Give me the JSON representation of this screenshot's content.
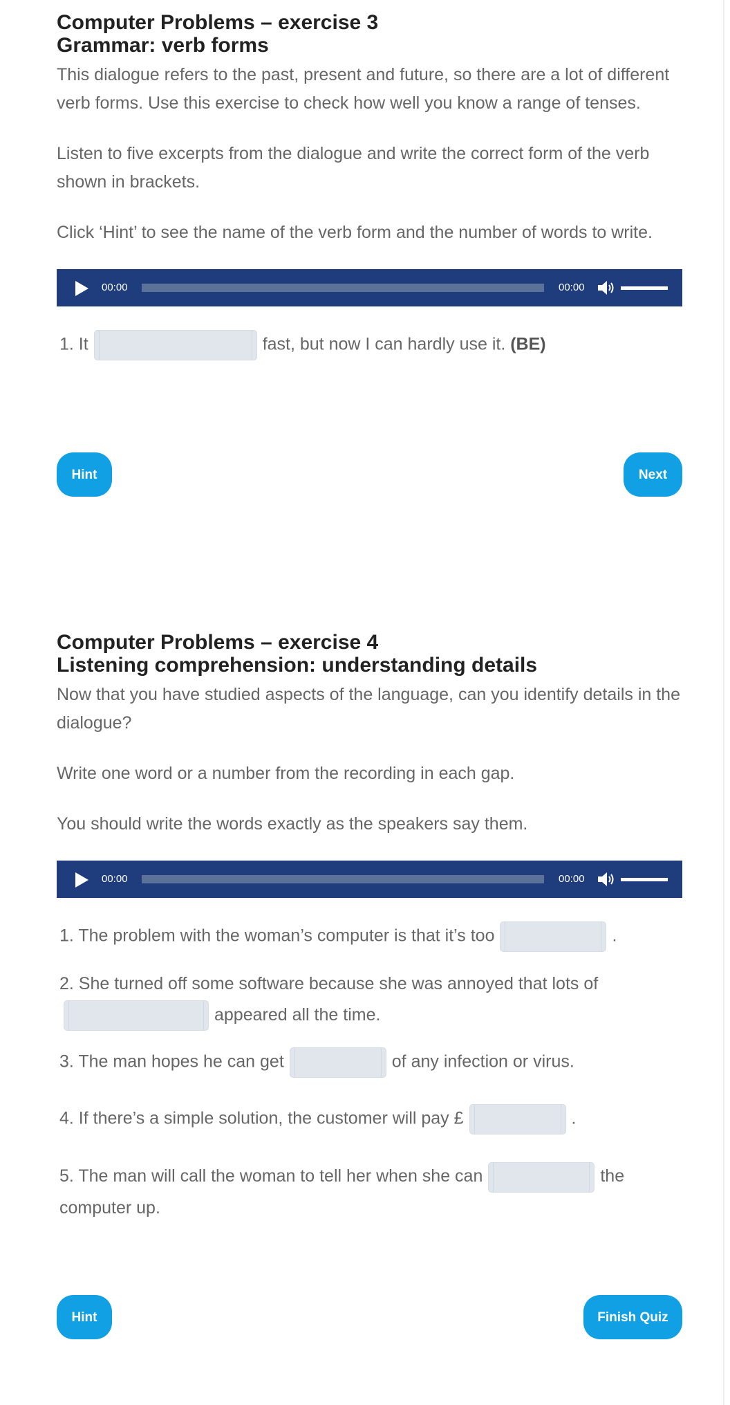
{
  "exercise3": {
    "title_line1": "Computer Problems – exercise 3",
    "title_line2": "Grammar: verb forms",
    "para1": "This dialogue refers to the past, present and future, so there are a lot of different verb forms. Use this exercise to check how well you know a range of tenses.",
    "para2": "Listen to five excerpts from the dialogue and write the correct form of the verb shown in brackets.",
    "para3": "Click ‘Hint’ to see the name of the verb form and the number of words to write.",
    "player": {
      "current_time": "00:00",
      "duration": "00:00"
    },
    "question": {
      "before": "1. It",
      "after": "fast, but now I can hardly use it.",
      "verb": "(BE)",
      "answer": ""
    },
    "hint_label": "Hint",
    "next_label": "Next"
  },
  "exercise4": {
    "title_line1": "Computer Problems – exercise 4",
    "title_line2": "Listening comprehension: understanding details",
    "para1": "Now that you have studied aspects of the language, can you identify details in the dialogue?",
    "para2": "Write one word or a number from the recording in each gap.",
    "para3": "You should write the words exactly as the speakers say them.",
    "player": {
      "current_time": "00:00",
      "duration": "00:00"
    },
    "questions": [
      {
        "before": "1. The problem with the woman’s computer is that it’s too",
        "after": ".",
        "answer": ""
      },
      {
        "before": "2. She turned off some software because she was annoyed that lots of",
        "after": "appeared all the time.",
        "answer": ""
      },
      {
        "before": "3. The man hopes he can get",
        "after": "of any infection or virus.",
        "answer": ""
      },
      {
        "before": "4. If there’s a simple solution, the customer will pay £",
        "after": ".",
        "answer": ""
      },
      {
        "before": "5. The man will call the woman to tell her when she can",
        "after": "the computer up.",
        "answer": ""
      }
    ],
    "hint_label": "Hint",
    "finish_label": "Finish Quiz"
  },
  "colors": {
    "accent_button": "#11a0e4",
    "player_background": "#1f3d7c",
    "input_background": "#e1e6ec",
    "heading_text": "#222222",
    "body_text": "#666666"
  },
  "icons": [
    "play-icon",
    "volume-icon"
  ]
}
